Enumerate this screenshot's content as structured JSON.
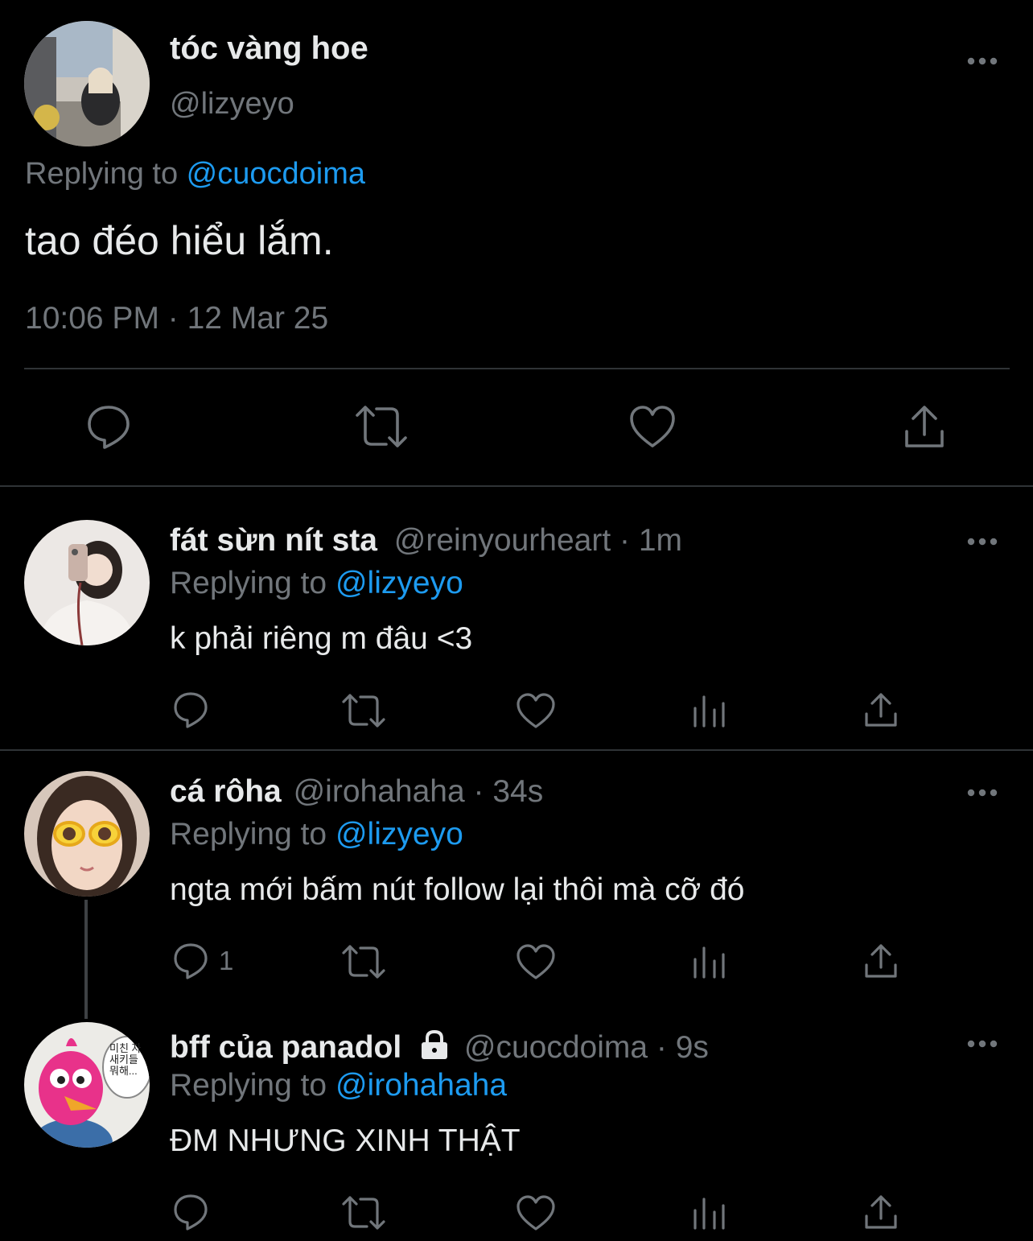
{
  "main_tweet": {
    "display_name": "tóc vàng hoe",
    "handle": "@lizyeyo",
    "replying_prefix": "Replying to ",
    "replying_to": "@cuocdoima",
    "text": "tao đéo hiểu lắm.",
    "timestamp": "10:06 PM · 12 Mar 25",
    "icons": [
      "reply-icon",
      "retweet-icon",
      "like-icon",
      "share-icon"
    ]
  },
  "replies": [
    {
      "display_name": "fát sừn nít sta",
      "handle": "@reinyourheart",
      "time": "· 1m",
      "replying_prefix": "Replying to ",
      "replying_to": "@lizyeyo",
      "text": "k phải riêng m đâu <3",
      "reply_count": ""
    },
    {
      "display_name": "cá rôha",
      "handle": "@irohahaha",
      "time": "· 34s",
      "replying_prefix": "Replying to ",
      "replying_to": "@lizyeyo",
      "text": "ngta mới bấm nút follow lại thôi mà cỡ đó",
      "reply_count": "1"
    },
    {
      "display_name": "bff của panadol",
      "handle": "@cuocdoima",
      "time": "· 9s",
      "replying_prefix": "Replying to ",
      "replying_to": "@irohahaha",
      "text": "ĐM NHƯNG XINH THẬT",
      "reply_count": "",
      "locked": true
    }
  ],
  "avatar_speech_bubble": "미친 자\n새키들\n뭐해...",
  "colors": {
    "background": "#000000",
    "text": "#e7e9ea",
    "muted": "#71767b",
    "accent": "#1d9bf0",
    "divider": "#2f3336"
  }
}
